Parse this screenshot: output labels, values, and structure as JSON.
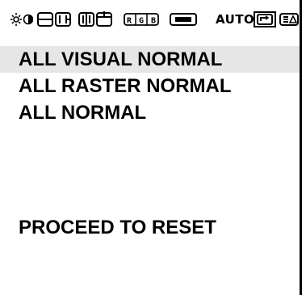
{
  "toolbar": {
    "icons": [
      "brightness-contrast-icon",
      "horizontal-position-icon",
      "horizontal-size-icon",
      "vertical-position-icon",
      "vertical-size-icon",
      "rgb-icon",
      "screen-icon",
      "auto-adjust-icon",
      "recall-icon",
      "factory-reset-icon"
    ],
    "rgb_label": "RGB",
    "auto_label": "AUTO",
    "active_icon": "recall-icon"
  },
  "menu": {
    "items": [
      {
        "label": "ALL VISUAL NORMAL",
        "selected": true
      },
      {
        "label": "ALL RASTER NORMAL",
        "selected": false
      },
      {
        "label": "ALL NORMAL",
        "selected": false
      }
    ]
  },
  "action": {
    "label": "PROCEED TO RESET"
  },
  "colors": {
    "background": "#ffffff",
    "text": "#000000",
    "highlight": "#e6e6e6"
  }
}
